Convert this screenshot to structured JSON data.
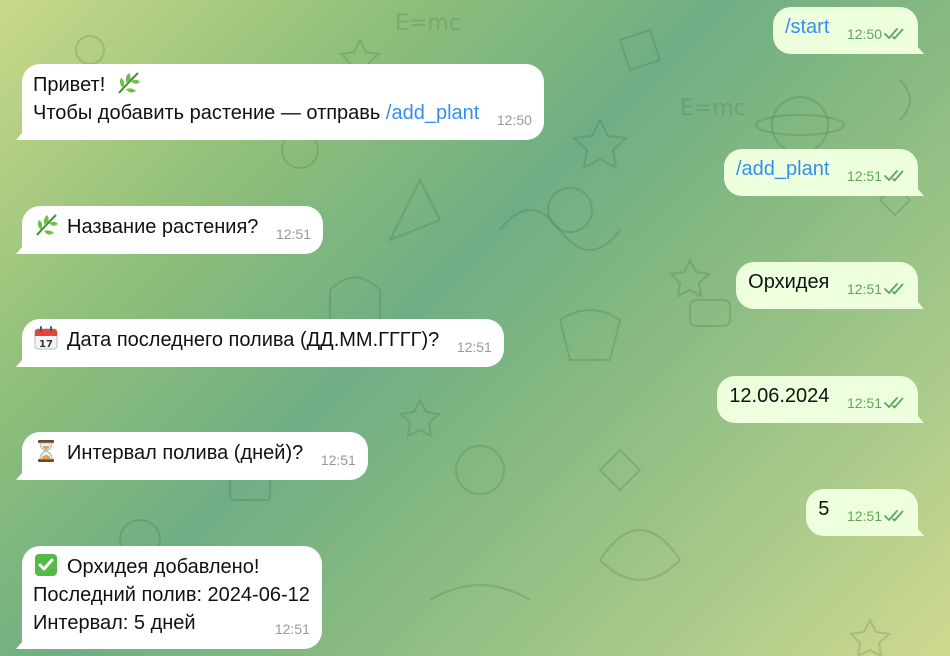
{
  "messages": [
    {
      "from": "user",
      "text": "/start",
      "time": "12:50",
      "is_command": true
    },
    {
      "from": "bot",
      "line1": "Привет!",
      "line2_prefix": "Чтобы добавить растение — отправь ",
      "line2_command": "/add_plant",
      "time": "12:50"
    },
    {
      "from": "user",
      "text": "/add_plant",
      "time": "12:51",
      "is_command": true
    },
    {
      "from": "bot",
      "icon": "herb-icon",
      "text": "Название растения?",
      "time": "12:51"
    },
    {
      "from": "user",
      "text": "Орхидея",
      "time": "12:51"
    },
    {
      "from": "bot",
      "icon": "calendar-icon",
      "text": "Дата последнего полива (ДД.ММ.ГГГГ)?",
      "time": "12:51"
    },
    {
      "from": "user",
      "text": "12.06.2024",
      "time": "12:51"
    },
    {
      "from": "bot",
      "icon": "hourglass-icon",
      "text": "Интервал полива (дней)?",
      "time": "12:51"
    },
    {
      "from": "user",
      "text": "5",
      "time": "12:51"
    },
    {
      "from": "bot",
      "icon": "check-mark-icon",
      "lines": [
        "Орхидея добавлено!",
        "Последний полив: 2024-06-12",
        "Интервал: 5 дней"
      ],
      "time": "12:51"
    }
  ],
  "colors": {
    "accent": "#3390ec",
    "outgoing_bubble": "#eeffde",
    "incoming_bubble": "#ffffff",
    "read_ticks": "#5fa65a"
  },
  "calendar_icon_day": "17"
}
